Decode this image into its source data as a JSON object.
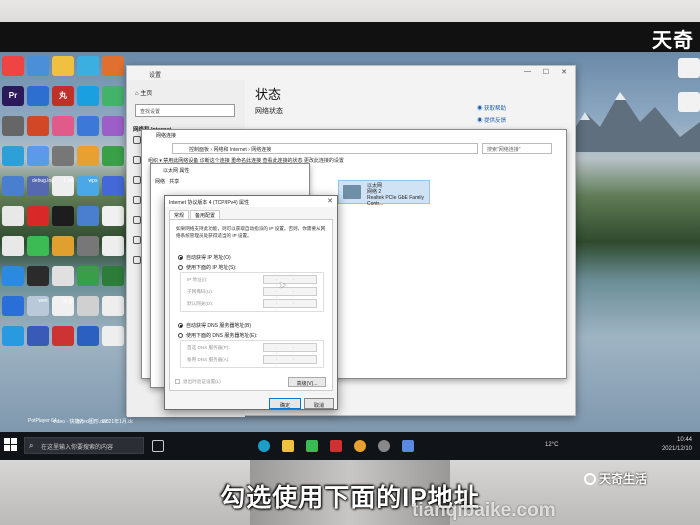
{
  "brand_top": "天奇",
  "caption": "勾选使用下面的IP地址",
  "brand_bottom": "天奇生活",
  "watermark": "tianqibaike.com",
  "desktop": {
    "icons_left": [
      {
        "label": "",
        "color": "#e44"
      },
      {
        "label": "",
        "color": "#4a8fd8"
      },
      {
        "label": "",
        "color": "#f0c040"
      },
      {
        "label": "",
        "color": "#3bb0e0"
      },
      {
        "label": "",
        "color": "#e07030"
      },
      {
        "label": "Pr",
        "color": "#2a1a5a"
      },
      {
        "label": "",
        "color": "#2c6fd0"
      },
      {
        "label": "丸",
        "color": "#c0302a"
      },
      {
        "label": "",
        "color": "#1aa0e0"
      },
      {
        "label": "",
        "color": "#44b36a"
      },
      {
        "label": "",
        "color": "#666"
      },
      {
        "label": "",
        "color": "#d24726"
      },
      {
        "label": "",
        "color": "#e05a8a"
      },
      {
        "label": "",
        "color": "#3c78d8"
      },
      {
        "label": "",
        "color": "#9c5fc8"
      },
      {
        "label": "",
        "color": "#2ea0d8"
      },
      {
        "label": "",
        "color": "#5a9ae8"
      },
      {
        "label": "",
        "color": "#777"
      },
      {
        "label": "",
        "color": "#e8a030"
      },
      {
        "label": "",
        "color": "#3aa048"
      },
      {
        "label": "",
        "color": "#4a7fd0"
      },
      {
        "label": "",
        "color": "#5568b0"
      },
      {
        "label": "",
        "color": "#eee"
      },
      {
        "label": "",
        "color": "#4aa8e8"
      },
      {
        "label": "",
        "color": "#4568d8"
      },
      {
        "label": "",
        "color": "#e8e8e8"
      },
      {
        "label": "",
        "color": "#d82828"
      },
      {
        "label": "",
        "color": "#1d1d1d"
      },
      {
        "label": "",
        "color": "#4a7fd0"
      },
      {
        "label": "",
        "color": "#f0f0f0"
      },
      {
        "label": "",
        "color": "#e8e8e8"
      },
      {
        "label": "",
        "color": "#3cba54"
      },
      {
        "label": "",
        "color": "#e0a030"
      },
      {
        "label": "",
        "color": "#777"
      },
      {
        "label": "",
        "color": "#eee"
      },
      {
        "label": "",
        "color": "#2a8ae0"
      },
      {
        "label": "",
        "color": "#2b2b2b"
      },
      {
        "label": "",
        "color": "#e0e0e0"
      },
      {
        "label": "",
        "color": "#3a9e48"
      },
      {
        "label": "",
        "color": "#2d7d3a"
      },
      {
        "label": "",
        "color": "#2a6fd8"
      },
      {
        "label": "",
        "color": "#b9c9d9"
      },
      {
        "label": "",
        "color": "#f0f0f0"
      },
      {
        "label": "",
        "color": "#d0d0d0"
      },
      {
        "label": "",
        "color": "#eee"
      },
      {
        "label": "",
        "color": "#2a9ae0"
      },
      {
        "label": "",
        "color": "#3a5ab8"
      },
      {
        "label": "",
        "color": "#c33"
      },
      {
        "label": "",
        "color": "#2b60c0"
      },
      {
        "label": "",
        "color": "#eee"
      }
    ],
    "icon_labels": [
      "debug.log",
      "1.txt",
      "wps",
      "",
      "wen",
      "抖音",
      "",
      "",
      "PotPlayer 64 bit",
      "video - 快捷方式",
      "word图形.docx",
      "2021年1月.docx"
    ]
  },
  "settings": {
    "title": "设置",
    "home": "主页",
    "find_placeholder": "查找设置",
    "section": "网络和 Internet",
    "page_title": "状态",
    "subtitle": "网络状态",
    "help1": "获取帮助",
    "help2": "提供反馈"
  },
  "netconn": {
    "title": "网络连接",
    "address": "控制面板 › 网络和 Internet › 网络连接",
    "search": "搜索\"网络连接\"",
    "commands": "组织 ▾   禁用此网络设备   诊断这个连接   重命名此连接   查看此连接的状态   更改此连接的设置",
    "adapter_name": "以太网",
    "adapter_net": "网络 2",
    "adapter_desc": "Realtek PCIe GbE Family Contr..."
  },
  "ethprops": {
    "title": "以太网 属性",
    "tab1": "网络",
    "tab2": "共享"
  },
  "ipv4": {
    "title": "Internet 协议版本 4 (TCP/IPv4) 属性",
    "tab_general": "常规",
    "tab_alt": "备用配置",
    "desc": "如果网络支持此功能，则可以获取自动指派的 IP 设置。否则，你需要从网络系统管理员处获得适当的 IP 设置。",
    "auto_ip": "自动获得 IP 地址(O)",
    "manual_ip": "使用下面的 IP 地址(S):",
    "ip_label": "IP 地址(I):",
    "mask_label": "子网掩码(U):",
    "gateway_label": "默认网关(D):",
    "auto_dns": "自动获得 DNS 服务器地址(B)",
    "manual_dns": "使用下面的 DNS 服务器地址(E):",
    "dns1_label": "首选 DNS 服务器(P):",
    "dns2_label": "备用 DNS 服务器(A):",
    "ip_placeholder": ". . .",
    "validate": "退出时验证设置(L)",
    "advanced": "高级(V)...",
    "ok": "确定",
    "cancel": "取消"
  },
  "taskbar": {
    "search": "在这里输入你要搜索的内容",
    "temp": "12°C",
    "time": "10:44",
    "date": "2021/12/10"
  }
}
